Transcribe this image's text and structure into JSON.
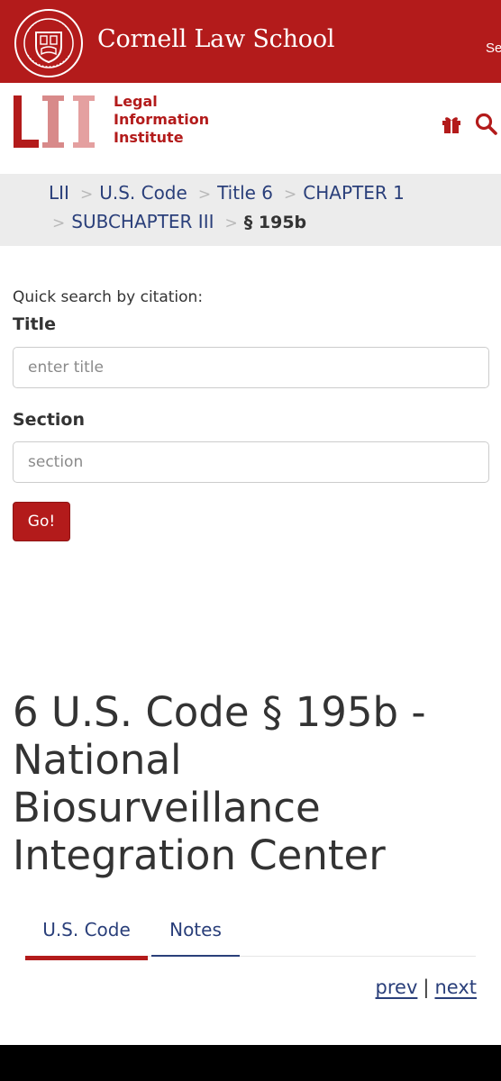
{
  "cornell_bar": {
    "title": "Cornell Law School",
    "search_cutoff": "Se"
  },
  "lii_header": {
    "logo_text": "LII",
    "name_lines": [
      "Legal",
      "Information",
      "Institute"
    ]
  },
  "breadcrumb": {
    "items": [
      "LII",
      "U.S. Code",
      "Title 6",
      "CHAPTER 1",
      "SUBCHAPTER III"
    ],
    "current": "§ 195b",
    "separator": ">"
  },
  "quick_search": {
    "heading": "Quick search by citation:",
    "title_label": "Title",
    "title_placeholder": "enter title",
    "section_label": "Section",
    "section_placeholder": "section",
    "go_label": "Go!"
  },
  "page": {
    "heading": "6 U.S. Code § 195b - National Biosurveillance Integration Center"
  },
  "tabs": [
    {
      "label": "U.S. Code",
      "active": true
    },
    {
      "label": "Notes",
      "active": false
    }
  ],
  "pager": {
    "prev": "prev",
    "divider": "|",
    "next": "next"
  },
  "colors": {
    "brand_red": "#b31b1b",
    "link_blue": "#2a3f7a"
  }
}
